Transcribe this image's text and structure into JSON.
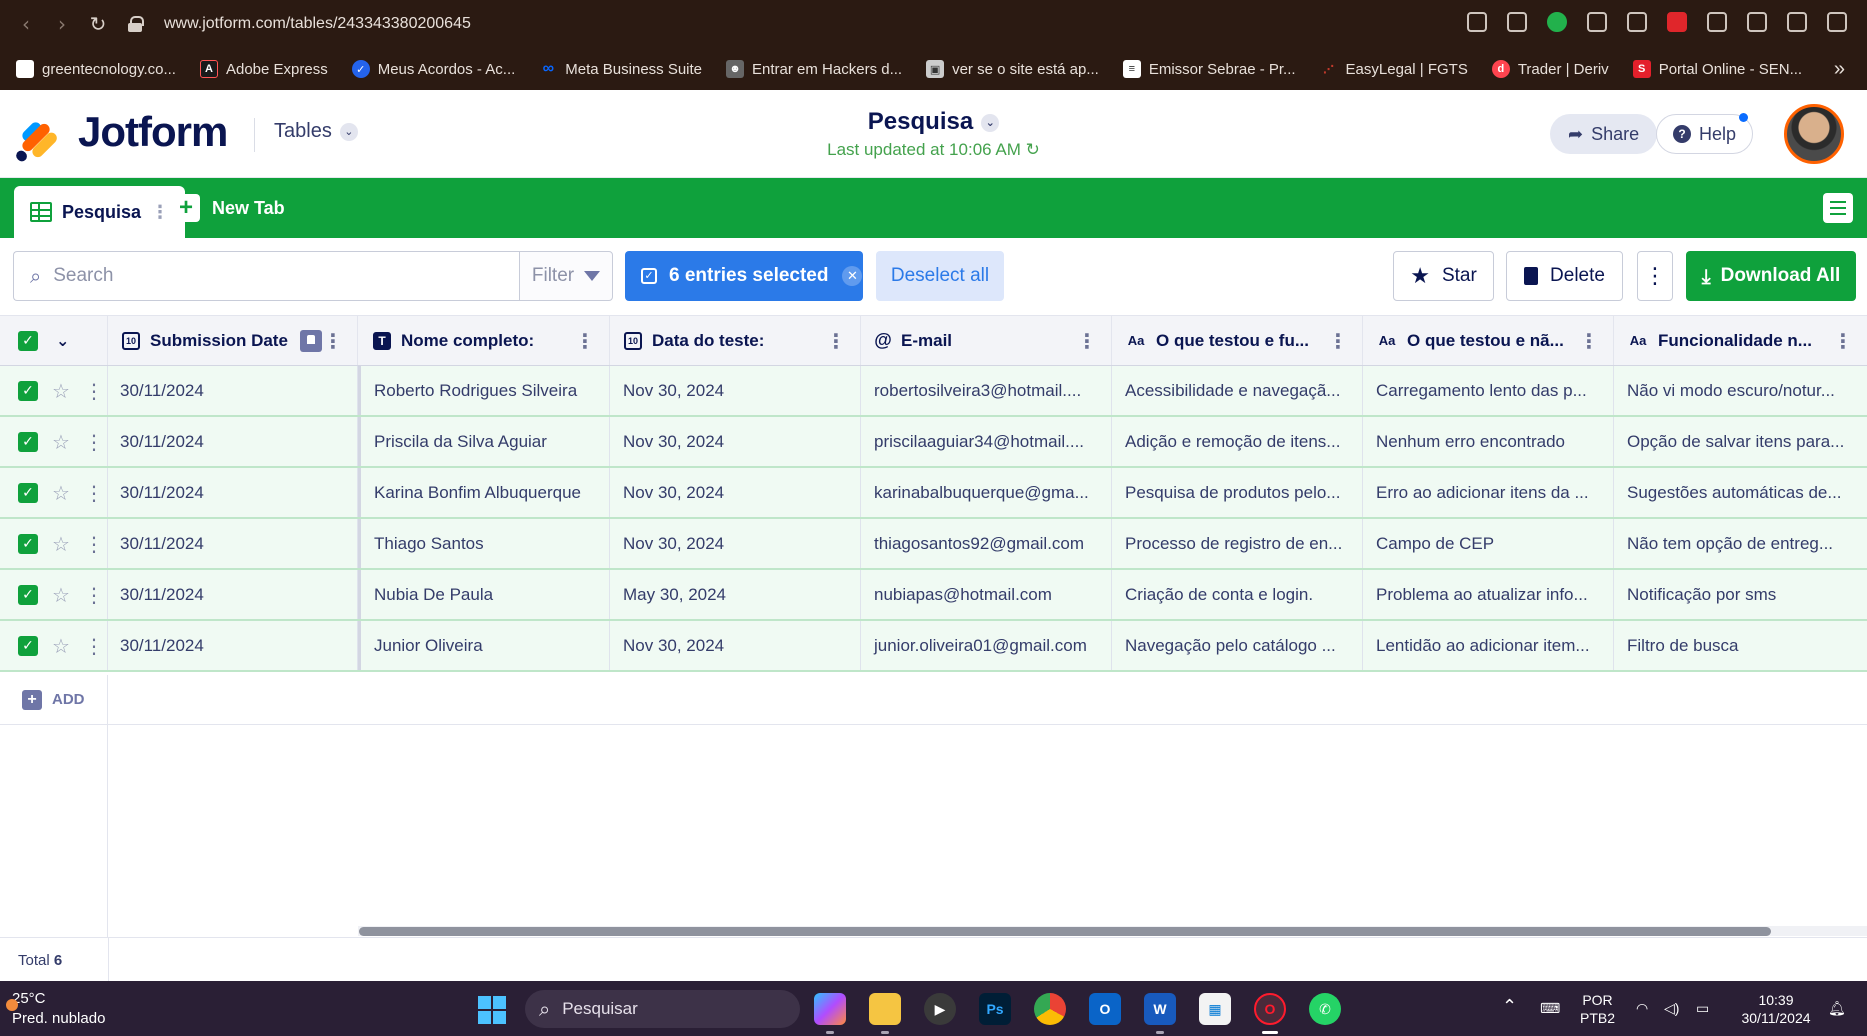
{
  "browser": {
    "url": "www.jotform.com/tables/243343380200645",
    "bookmarks": [
      {
        "label": "greentecnology.co...",
        "icon": "page-icon",
        "color": "#ffffff"
      },
      {
        "label": "Adobe Express",
        "icon": "adobe-express-icon",
        "color": "#1a1a1a"
      },
      {
        "label": "Meus Acordos - Ac...",
        "icon": "shield-icon",
        "color": "#2463eb"
      },
      {
        "label": "Meta Business Suite",
        "icon": "meta-icon",
        "color": "#0866ff"
      },
      {
        "label": "Entrar em Hackers d...",
        "icon": "hacker-icon",
        "color": "#888888"
      },
      {
        "label": "ver se o site está ap...",
        "icon": "page-icon",
        "color": "#cccccc"
      },
      {
        "label": "Emissor Sebrae - Pr...",
        "icon": "document-icon",
        "color": "#ffffff"
      },
      {
        "label": "EasyLegal | FGTS",
        "icon": "easylegal-icon",
        "color": "#c0392b"
      },
      {
        "label": "Trader | Deriv",
        "icon": "deriv-icon",
        "color": "#ff444f"
      },
      {
        "label": "Portal Online - SEN...",
        "icon": "senai-icon",
        "color": "#e4202b"
      }
    ]
  },
  "header": {
    "brand": "Jotform",
    "tables_label": "Tables",
    "doc_title": "Pesquisa",
    "last_updated": "Last updated at 10:06 AM",
    "share_label": "Share",
    "help_label": "Help"
  },
  "tabs": {
    "active_label": "Pesquisa",
    "new_tab_label": "New Tab"
  },
  "toolbar": {
    "search_placeholder": "Search",
    "filter_label": "Filter",
    "selected_label": "6 entries selected",
    "deselect_label": "Deselect all",
    "star_label": "Star",
    "delete_label": "Delete",
    "download_label": "Download All"
  },
  "table": {
    "columns": [
      {
        "label": "Submission Date",
        "icon": "calendar-icon"
      },
      {
        "label": "Nome completo:",
        "icon": "text-icon"
      },
      {
        "label": "Data do teste:",
        "icon": "calendar-icon"
      },
      {
        "label": "E-mail",
        "icon": "at-icon"
      },
      {
        "label": "O que testou e fu...",
        "icon": "aa-icon"
      },
      {
        "label": "O que testou e nã...",
        "icon": "aa-icon"
      },
      {
        "label": "Funcionalidade n...",
        "icon": "aa-icon"
      }
    ],
    "rows": [
      [
        "30/11/2024",
        "Roberto Rodrigues Silveira",
        "Nov 30, 2024",
        "robertosilveira3@hotmail....",
        "Acessibilidade e navegaçã...",
        "Carregamento lento das p...",
        "Não vi modo escuro/notur..."
      ],
      [
        "30/11/2024",
        "Priscila da Silva Aguiar",
        "Nov 30, 2024",
        "priscilaaguiar34@hotmail....",
        "Adição e remoção de itens...",
        "Nenhum erro encontrado",
        "Opção de salvar itens para..."
      ],
      [
        "30/11/2024",
        "Karina Bonfim Albuquerque",
        "Nov 30, 2024",
        "karinabalbuquerque@gma...",
        "Pesquisa de produtos pelo...",
        "Erro ao adicionar itens da ...",
        "Sugestões automáticas de..."
      ],
      [
        "30/11/2024",
        "Thiago Santos",
        "Nov 30, 2024",
        "thiagosantos92@gmail.com",
        "Processo de registro de en...",
        "Campo de CEP",
        "Não tem opção de entreg..."
      ],
      [
        "30/11/2024",
        "Nubia De Paula",
        "May 30, 2024",
        "nubiapas@hotmail.com",
        "Criação de conta e login.",
        "Problema ao atualizar info...",
        "Notificação por sms"
      ],
      [
        "30/11/2024",
        "Junior Oliveira",
        "Nov 30, 2024",
        "junior.oliveira01@gmail.com",
        "Navegação pelo catálogo ...",
        "Lentidão ao adicionar item...",
        "Filtro de busca"
      ]
    ],
    "add_label": "ADD",
    "total_label": "Total",
    "total_count": "6"
  },
  "taskbar": {
    "temperature": "25°C",
    "weather": "Pred. nublado",
    "search_placeholder": "Pesquisar",
    "language": "POR",
    "layout": "PTB2",
    "time": "10:39",
    "date": "30/11/2024"
  },
  "colors": {
    "brand_green": "#0fa13c",
    "accent_blue": "#2b7ae8",
    "navy": "#0a1551"
  }
}
